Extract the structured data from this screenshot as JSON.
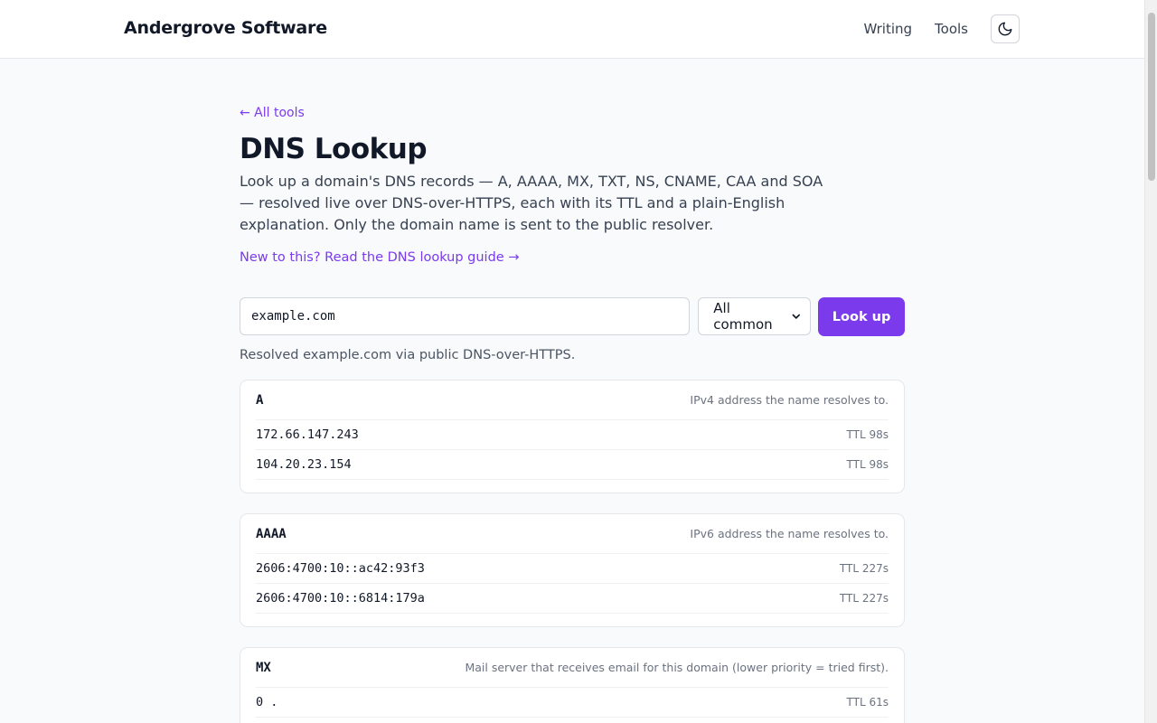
{
  "header": {
    "brand": "Andergrove Software",
    "nav": [
      "Writing",
      "Tools"
    ],
    "theme_icon": "moon-icon"
  },
  "page": {
    "back_link": "← All tools",
    "title": "DNS Lookup",
    "intro": "Look up a domain's DNS records — A, AAAA, MX, TXT, NS, CNAME, CAA and SOA — resolved live over DNS-over-HTTPS, each with its TTL and a plain-English explanation. Only the domain name is sent to the public resolver.",
    "guide_link": "New to this? Read the DNS lookup guide →"
  },
  "form": {
    "domain_value": "example.com",
    "type_selected": "All common",
    "submit_label": "Look up"
  },
  "status": "Resolved example.com via public DNS-over-HTTPS.",
  "records": [
    {
      "type": "A",
      "description": "IPv4 address the name resolves to.",
      "rows": [
        {
          "value": "172.66.147.243",
          "ttl": "TTL 98s"
        },
        {
          "value": "104.20.23.154",
          "ttl": "TTL 98s"
        }
      ]
    },
    {
      "type": "AAAA",
      "description": "IPv6 address the name resolves to.",
      "rows": [
        {
          "value": "2606:4700:10::ac42:93f3",
          "ttl": "TTL 227s"
        },
        {
          "value": "2606:4700:10::6814:179a",
          "ttl": "TTL 227s"
        }
      ]
    },
    {
      "type": "MX",
      "description": "Mail server that receives email for this domain (lower priority = tried first).",
      "rows": [
        {
          "value": "0 .",
          "ttl": "TTL 61s"
        }
      ]
    }
  ],
  "colors": {
    "accent": "#7c3aed",
    "background": "#f8fafc",
    "text": "#111827",
    "muted": "#6b7280"
  }
}
